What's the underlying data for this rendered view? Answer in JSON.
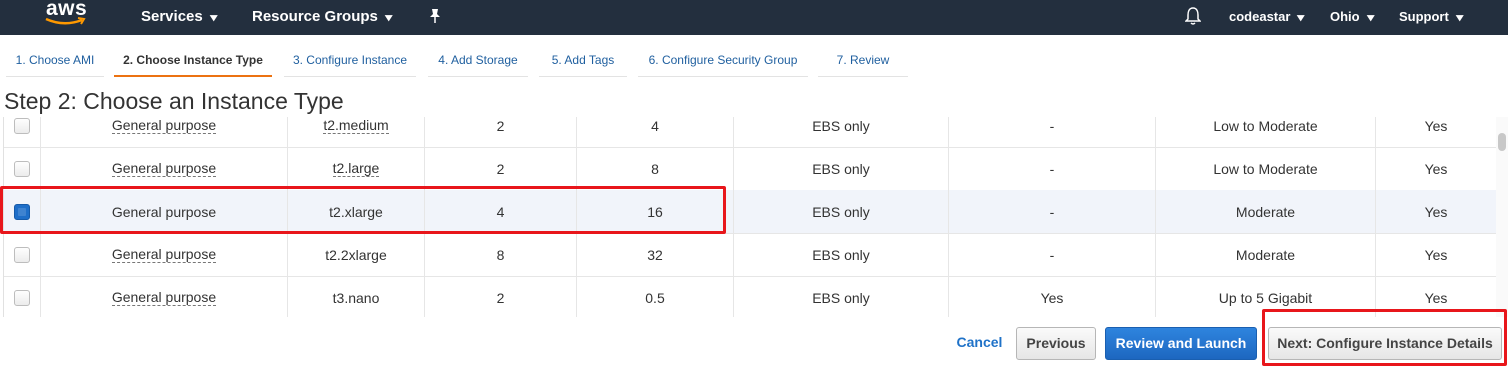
{
  "topnav": {
    "logo": "aws",
    "services": "Services",
    "resource_groups": "Resource Groups",
    "account": "codeastar",
    "region": "Ohio",
    "support": "Support"
  },
  "tabs": [
    {
      "label": "1. Choose AMI"
    },
    {
      "label": "2. Choose Instance Type"
    },
    {
      "label": "3. Configure Instance"
    },
    {
      "label": "4. Add Storage"
    },
    {
      "label": "5. Add Tags"
    },
    {
      "label": "6. Configure Security Group"
    },
    {
      "label": "7. Review"
    }
  ],
  "page_title": "Step 2: Choose an Instance Type",
  "rows": [
    {
      "checked": false,
      "family": "General purpose",
      "type": "t2.medium",
      "vcpus": "2",
      "memory": "4",
      "storage": "EBS only",
      "ebs_optimized": "-",
      "network": "Low to Moderate",
      "ipv6": "Yes"
    },
    {
      "checked": false,
      "family": "General purpose",
      "type": "t2.large",
      "vcpus": "2",
      "memory": "8",
      "storage": "EBS only",
      "ebs_optimized": "-",
      "network": "Low to Moderate",
      "ipv6": "Yes"
    },
    {
      "checked": true,
      "family": "General purpose",
      "type": "t2.xlarge",
      "vcpus": "4",
      "memory": "16",
      "storage": "EBS only",
      "ebs_optimized": "-",
      "network": "Moderate",
      "ipv6": "Yes"
    },
    {
      "checked": false,
      "family": "General purpose",
      "type": "t2.2xlarge",
      "vcpus": "8",
      "memory": "32",
      "storage": "EBS only",
      "ebs_optimized": "-",
      "network": "Moderate",
      "ipv6": "Yes"
    },
    {
      "checked": false,
      "family": "General purpose",
      "type": "t3.nano",
      "vcpus": "2",
      "memory": "0.5",
      "storage": "EBS only",
      "ebs_optimized": "Yes",
      "network": "Up to 5 Gigabit",
      "ipv6": "Yes"
    }
  ],
  "buttons": {
    "cancel": "Cancel",
    "previous": "Previous",
    "review_launch": "Review and Launch",
    "next": "Next: Configure Instance Details"
  },
  "colors": {
    "nav_bg": "#232f3e",
    "active_tab": "#ec7211",
    "primary_button": "#1d67c0",
    "highlight_box": "#e8161b"
  }
}
